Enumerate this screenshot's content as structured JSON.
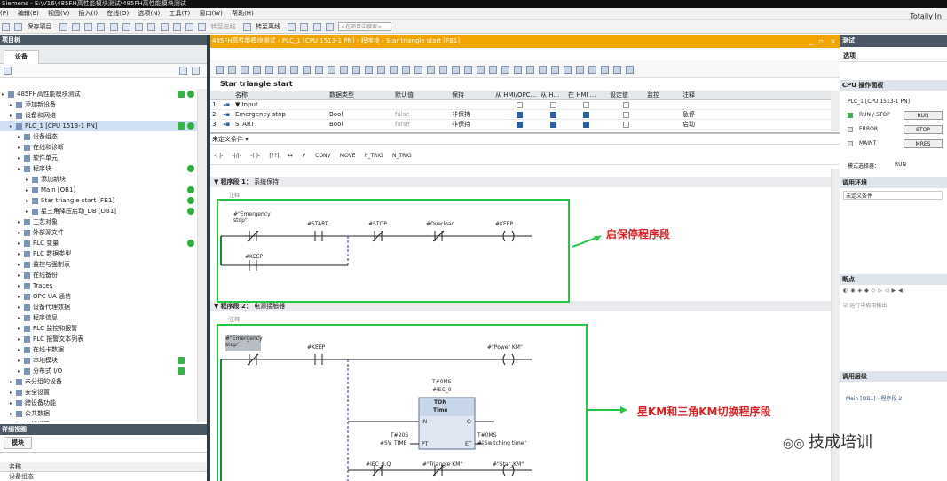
{
  "title_bar": {
    "text": "Siemens  -  E:\\V16\\485FH高性能模块测试\\485FH高性能模块测试"
  },
  "menu": [
    "编辑(E)",
    "视图(V)",
    "插入(I)",
    "在线(O)",
    "选项(N)",
    "工具(T)",
    "窗口(W)",
    "帮助(H)"
  ],
  "menu_prefix": "(P)",
  "toolbar": {
    "save": "保存项目",
    "go_online": "转至在线",
    "go_offline": "转至离线",
    "search_placeholder": "<在项目中搜索>"
  },
  "brand": "Totally In",
  "left_panel": {
    "title": "项目树",
    "tab": "设备",
    "tree": [
      {
        "label": "485FH高性能模块测试",
        "depth": 0,
        "check": true,
        "dot": true
      },
      {
        "label": "添加新设备",
        "depth": 1
      },
      {
        "label": "设备和网络",
        "depth": 1
      },
      {
        "label": "PLC_1 [CPU 1513-1 PN]",
        "depth": 1,
        "check": true,
        "dot": true,
        "selected": true
      },
      {
        "label": "设备组态",
        "depth": 2
      },
      {
        "label": "在线和诊断",
        "depth": 2
      },
      {
        "label": "软件单元",
        "depth": 2
      },
      {
        "label": "程序块",
        "depth": 2,
        "dot": true
      },
      {
        "label": "添加新块",
        "depth": 3
      },
      {
        "label": "Main [OB1]",
        "depth": 3,
        "dot": true
      },
      {
        "label": "Star triangle start [FB1]",
        "depth": 3,
        "dot": true
      },
      {
        "label": "星三角降压启动_DB [DB1]",
        "depth": 3,
        "dot": true
      },
      {
        "label": "工艺对象",
        "depth": 2
      },
      {
        "label": "外部源文件",
        "depth": 2
      },
      {
        "label": "PLC 变量",
        "depth": 2,
        "dot": true
      },
      {
        "label": "PLC 数据类型",
        "depth": 2
      },
      {
        "label": "监控与强制表",
        "depth": 2
      },
      {
        "label": "在线备份",
        "depth": 2
      },
      {
        "label": "Traces",
        "depth": 2
      },
      {
        "label": "OPC UA 通信",
        "depth": 2
      },
      {
        "label": "设备代理数据",
        "depth": 2
      },
      {
        "label": "程序信息",
        "depth": 2
      },
      {
        "label": "PLC 监控和报警",
        "depth": 2
      },
      {
        "label": "PLC 报警文本列表",
        "depth": 2
      },
      {
        "label": "在线卡数据",
        "depth": 2
      },
      {
        "label": "本地模块",
        "depth": 2,
        "check": true
      },
      {
        "label": "分布式 I/O",
        "depth": 2,
        "check": true
      },
      {
        "label": "未分组的设备",
        "depth": 1
      },
      {
        "label": "安全设置",
        "depth": 1
      },
      {
        "label": "跨设备功能",
        "depth": 1
      },
      {
        "label": "公共数据",
        "depth": 1
      },
      {
        "label": "文档设置",
        "depth": 1
      }
    ],
    "detail_title": "详细视图",
    "module_tab": "模块",
    "name_header": "名称",
    "name_row": "设备组态"
  },
  "editor": {
    "tab_path": "485FH高性能模块测试  ›  PLC_1 [CPU 1513-1 PN]  ›  程序块  ›  Star triangle start [FB1]",
    "block_name": "Star triangle start",
    "iface_headers": [
      "名称",
      "数据类型",
      "默认值",
      "保持",
      "从 HMI/OPC...",
      "从 H...",
      "在 HMI ...",
      "设定值",
      "监控",
      "注释"
    ],
    "iface_rows": [
      {
        "num": "1",
        "name": "▼ Input",
        "type": "",
        "default": "",
        "retain": "",
        "comment": ""
      },
      {
        "num": "2",
        "name": "Emergency stop",
        "type": "Bool",
        "default": "false",
        "retain": "非保持",
        "comment": "急停"
      },
      {
        "num": "3",
        "name": "START",
        "type": "Bool",
        "default": "false",
        "retain": "非保持",
        "comment": "启动"
      }
    ],
    "condition": "未定义条件",
    "ladder_ops": [
      "CONV",
      "MOVE",
      "P_TRIG",
      "N_TRIG"
    ],
    "networks": [
      {
        "label": "程序段 1：",
        "title": "系统保持",
        "comment": "注释"
      },
      {
        "label": "程序段 2：",
        "title": "电源接触器",
        "comment": "注释"
      }
    ],
    "n1": {
      "estop": "#\"Emergency\nstop\"",
      "start": "#START",
      "stop": "#STOP",
      "overload": "#Overload",
      "keep_coil": "#KEEP",
      "keep_contact": "#KEEP"
    },
    "n2": {
      "estop": "#\"Emergency\nstop\"",
      "keep": "#KEEP",
      "power_coil": "#\"Power KM\"",
      "timer_db": "T#0MS",
      "timer_inst": "#IEC_0",
      "timer_type": "TON",
      "timer_sub": "Time",
      "pin_in": "IN",
      "pin_q": "Q",
      "pin_pt": "PT",
      "pin_et": "ET",
      "pt_val": "T#20S",
      "pt_var": "#SV_TIME",
      "et_val": "T#0MS",
      "et_var": "#\"Switching time\"",
      "iec_q": "#IEC_0.Q",
      "tri_km": "#\"Triangle KM\"",
      "star_km": "#\"Star_KM\""
    },
    "callout1": "启保停程序段",
    "callout2": "星KM和三角KM切换程序段"
  },
  "right_panel": {
    "title": "测试",
    "options": "选项",
    "cpu_panel": "CPU 操作面板",
    "plc": "PLC_1 [CPU 1513-1 PN]",
    "run_stop": "RUN / STOP",
    "error": "ERROR",
    "maint": "MAINT",
    "btn_run": "RUN",
    "btn_stop": "STOP",
    "btn_mres": "MRES",
    "mode_label": "模式选择器：",
    "mode_val": "RUN",
    "call_env": "调用环境",
    "call_env_val": "未定义条件",
    "breakpoints": "断点",
    "bp_opt": "运行中启用输出",
    "call_hier": "调用层级",
    "call_hier_val": "Main [OB1] - 程序段 2"
  },
  "watermark": "技成培训",
  "colors": {
    "accent_orange": "#f2a400",
    "panel_dark": "#4a5866",
    "annot_green": "#22c744",
    "callout_red": "#e02020"
  }
}
